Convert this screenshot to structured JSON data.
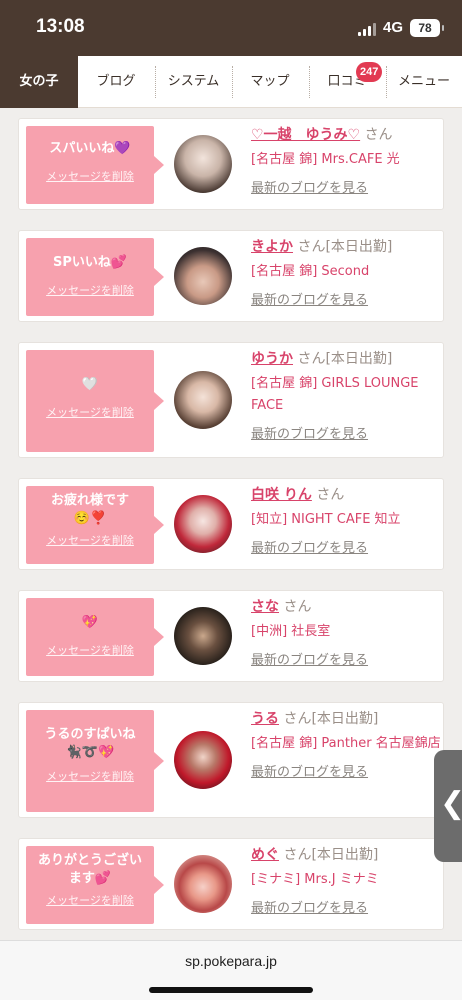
{
  "status": {
    "time": "13:08",
    "network": "4G",
    "battery": "78"
  },
  "nav": {
    "tabs": [
      "女の子",
      "ブログ",
      "システム",
      "マップ",
      "口コミ",
      "メニュー"
    ],
    "badge": "247"
  },
  "likes": [
    {
      "message": "スパいいね💜",
      "delete": "メッセージを削除",
      "name": "♡一越　ゆうみ♡",
      "suffix": "さん",
      "status": "",
      "shop": "[名古屋 錦] Mrs.CAFE 光",
      "blog": "最新のブログを見る"
    },
    {
      "message": "SPいいね💕",
      "delete": "メッセージを削除",
      "name": "きよか",
      "suffix": "さん",
      "status": "[本日出勤]",
      "shop": "[名古屋 錦] Second",
      "blog": "最新のブログを見る"
    },
    {
      "message": "🤍",
      "delete": "メッセージを削除",
      "name": "ゆうか",
      "suffix": "さん",
      "status": "[本日出勤]",
      "shop": "[名古屋 錦] GIRLS LOUNGE FACE",
      "blog": "最新のブログを見る"
    },
    {
      "message": "お疲れ様です☺️❣️",
      "delete": "メッセージを削除",
      "name": "白咲 りん",
      "suffix": "さん",
      "status": "",
      "shop": "[知立] NIGHT CAFE 知立",
      "blog": "最新のブログを見る"
    },
    {
      "message": "💖",
      "delete": "メッセージを削除",
      "name": "さな",
      "suffix": "さん",
      "status": "",
      "shop": "[中洲] 社長室",
      "blog": "最新のブログを見る"
    },
    {
      "message": "うるのすぱいね🐈‍⬛➰💖",
      "delete": "メッセージを削除",
      "name": "うる",
      "suffix": "さん",
      "status": "[本日出勤]",
      "shop": "[名古屋 錦] Panther 名古屋錦店",
      "blog": "最新のブログを見る"
    },
    {
      "message": "ありがとうございます💕",
      "delete": "メッセージを削除",
      "name": "めぐ",
      "suffix": "さん",
      "status": "[本日出勤]",
      "shop": "[ミナミ] Mrs.J ミナミ",
      "blog": "最新のブログを見る"
    }
  ],
  "url": "sp.pokepara.jp",
  "colors": {
    "brand_brown": "#4b3a30",
    "pink_bubble": "#f7a1ae",
    "link_pink": "#d8436a",
    "badge_red": "#e23a52"
  }
}
